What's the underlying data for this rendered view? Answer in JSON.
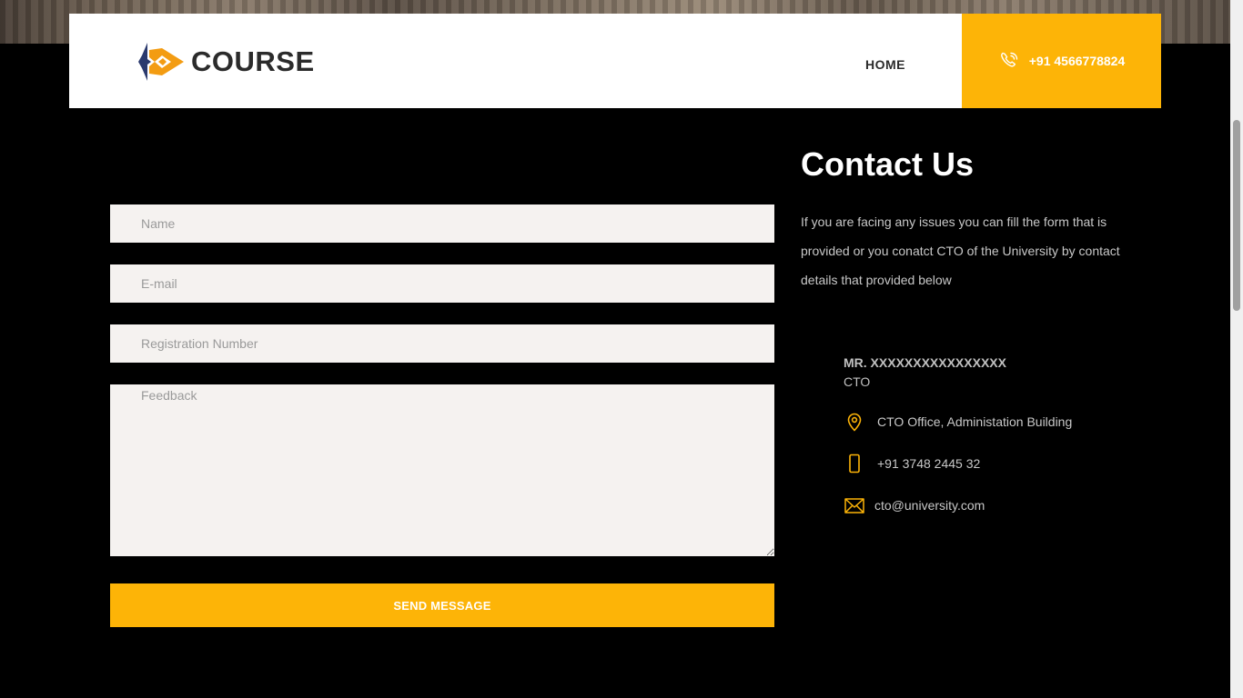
{
  "brand": {
    "name": "COURSE"
  },
  "nav": {
    "home": "HOME"
  },
  "header": {
    "phone": "+91 4566778824"
  },
  "form": {
    "name_placeholder": "Name",
    "email_placeholder": "E-mail",
    "registration_placeholder": "Registration Number",
    "feedback_placeholder": "Feedback",
    "name_value": "",
    "email_value": "",
    "registration_value": "",
    "feedback_value": "",
    "submit_label": "SEND MESSAGE"
  },
  "contact": {
    "title": "Contact Us",
    "description": "If you are facing any issues you can fill the form that is provided or you conatct CTO of the University by contact details that provided below",
    "person_name": "MR. XXXXXXXXXXXXXXXX",
    "person_role": "CTO",
    "address": "CTO Office, Administation Building",
    "phone": "+91 3748 2445 32",
    "email": "cto@university.com"
  },
  "colors": {
    "accent": "#fdb407",
    "background": "#000000",
    "field_bg": "#f5f2f0",
    "logo_navy": "#2b3a6e",
    "logo_orange": "#f39c12"
  },
  "icons": {
    "logo": "course-logo-icon",
    "header_phone": "phone-ringing-icon",
    "address": "map-pin-icon",
    "phone": "mobile-phone-icon",
    "email": "envelope-icon"
  }
}
